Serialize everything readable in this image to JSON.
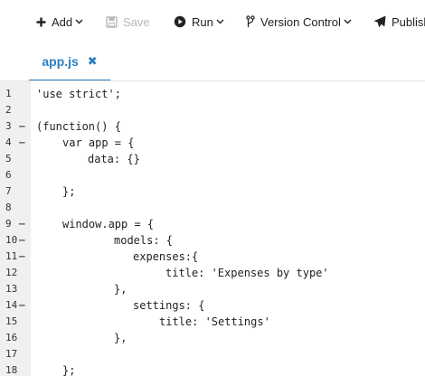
{
  "toolbar": {
    "add_label": "Add",
    "save_label": "Save",
    "run_label": "Run",
    "version_control_label": "Version Control",
    "publish_label": "Publish"
  },
  "tab": {
    "title": "app.js",
    "close_glyph": "✖"
  },
  "editor": {
    "lines": [
      {
        "number": "1",
        "text": "'use strict';",
        "fold": ""
      },
      {
        "number": "2",
        "text": "",
        "fold": ""
      },
      {
        "number": "3",
        "text": "(function() {",
        "fold": "—"
      },
      {
        "number": "4",
        "text": "var app = {",
        "fold": "—"
      },
      {
        "number": "5",
        "text": "data: {}",
        "fold": ""
      },
      {
        "number": "6",
        "text": "",
        "fold": ""
      },
      {
        "number": "7",
        "text": "};",
        "fold": ""
      },
      {
        "number": "8",
        "text": "",
        "fold": ""
      },
      {
        "number": "9",
        "text": "window.app = {",
        "fold": "—"
      },
      {
        "number": "10",
        "text": "models: {",
        "fold": "—"
      },
      {
        "number": "11",
        "text": "expenses:{",
        "fold": "—"
      },
      {
        "number": "12",
        "text": "title: 'Expenses by type'",
        "fold": ""
      },
      {
        "number": "13",
        "text": "},",
        "fold": ""
      },
      {
        "number": "14",
        "text": "settings: {",
        "fold": "—"
      },
      {
        "number": "15",
        "text": "title: 'Settings'",
        "fold": ""
      },
      {
        "number": "16",
        "text": "},",
        "fold": ""
      },
      {
        "number": "17",
        "text": "",
        "fold": ""
      },
      {
        "number": "18",
        "text": "};",
        "fold": ""
      }
    ]
  },
  "colors": {
    "accent": "#2a7fc0",
    "gutter_bg": "#f0f0f0",
    "disabled": "#b8b8b8"
  },
  "icons": {
    "add": "plus-icon",
    "save": "floppy-disk-icon",
    "run": "play-circle-icon",
    "version_control": "branch-icon",
    "publish": "paper-plane-icon"
  }
}
